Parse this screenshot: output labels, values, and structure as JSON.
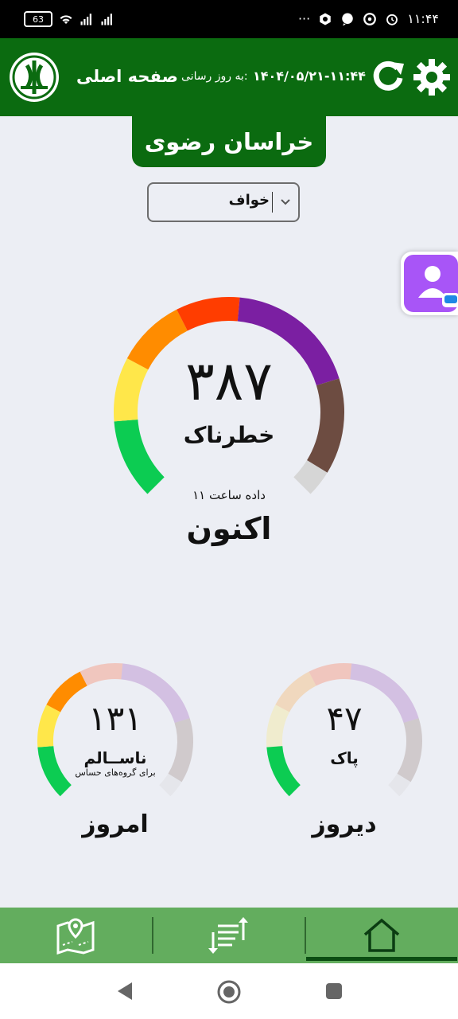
{
  "status_bar": {
    "battery": "63",
    "time": "۱۱:۴۴",
    "dots": "···"
  },
  "header": {
    "title": "صفحه اصلی",
    "update_label": "به روز رسانی:",
    "update_time": "۱۴۰۴/۰۵/۲۱-۱۱:۴۴"
  },
  "province": "خراسان رضوی",
  "city_select": {
    "selected": "خواف"
  },
  "current": {
    "value": "۳۸۷",
    "status": "خطرناک",
    "data_hour": "داده ساعت ۱۱",
    "label": "اکنون",
    "level_fraction": 0.97
  },
  "today": {
    "value": "۱۳۱",
    "status": "ناســالم",
    "sub": "برای گروه‌های حساس",
    "label": "امروز",
    "level_fraction": 0.33
  },
  "yesterday": {
    "value": "۴۷",
    "status": "پاک",
    "label": "دیروز",
    "level_fraction": 0.12
  },
  "colors": {
    "header_green": "#0b6b10",
    "nav_green": "#63ad5e",
    "good": "#0ccc52",
    "moderate": "#ffe74a",
    "sensitive": "#ff8c00",
    "unhealthy": "#ff3d00",
    "very_unhealthy": "#7b1fa2",
    "hazardous": "#6d4c41",
    "beyond": "#d6d6d6"
  },
  "bottom_nav": {
    "items": [
      "map-icon",
      "sort-list-icon",
      "home-icon"
    ],
    "active": "home-icon"
  }
}
